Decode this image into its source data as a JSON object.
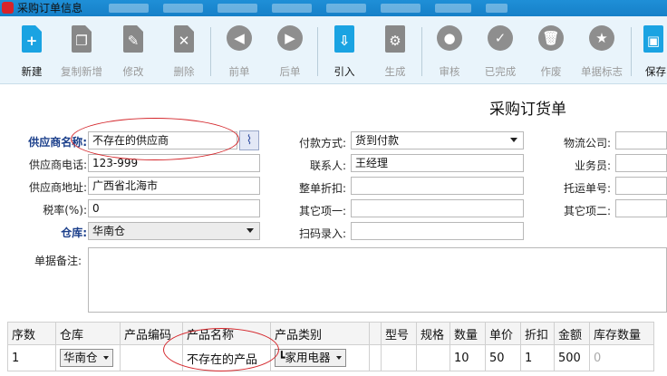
{
  "window": {
    "title": "采购订单信息"
  },
  "toolbar": {
    "new": "新建",
    "copy_new": "复制新增",
    "edit": "修改",
    "delete": "删除",
    "prev": "前单",
    "next": "后单",
    "import": "引入",
    "generate": "生成",
    "audit": "审核",
    "completed": "已完成",
    "void": "作废",
    "mark": "单据标志",
    "save": "保存"
  },
  "form": {
    "title": "采购订货单",
    "supplier_name_label": "供应商名称:",
    "supplier_name": "不存在的供应商",
    "supplier_phone_label": "供应商电话:",
    "supplier_phone": "123-999",
    "supplier_address_label": "供应商地址:",
    "supplier_address": "广西省北海市",
    "tax_rate_label": "税率(%):",
    "tax_rate": "0",
    "warehouse_label": "仓库:",
    "warehouse": "华南仓",
    "payment_label": "付款方式:",
    "payment": "货到付款",
    "contact_label": "联系人:",
    "contact": "王经理",
    "discount_label": "整单折扣:",
    "discount": "",
    "other1_label": "其它项一:",
    "other1": "",
    "barcode_label": "扫码录入:",
    "barcode": "",
    "logistics_label": "物流公司:",
    "logistics": "",
    "salesman_label": "业务员:",
    "salesman": "",
    "waybill_label": "托运单号:",
    "waybill": "",
    "other2_label": "其它项二:",
    "other2": "",
    "memo_label": "单据备注:",
    "memo": ""
  },
  "grid": {
    "headers": [
      "序数",
      "仓库",
      "产品编码",
      "产品名称",
      "产品类别",
      "",
      "型号",
      "规格",
      "数量",
      "单价",
      "折扣",
      "金额",
      "库存数量"
    ],
    "row": {
      "index": "1",
      "warehouse": "华南仓",
      "code": "",
      "name": "不存在的产品",
      "category": "家用电器",
      "model": "",
      "spec": "",
      "qty": "10",
      "price": "50",
      "discount": "1",
      "amount": "500",
      "stock": "0"
    }
  },
  "colors": {
    "titlebar": "#1f8fd7",
    "toolbar_bg": "#e9f4fb",
    "accent": "#1aa3e2",
    "annotation": "#d4262b"
  }
}
